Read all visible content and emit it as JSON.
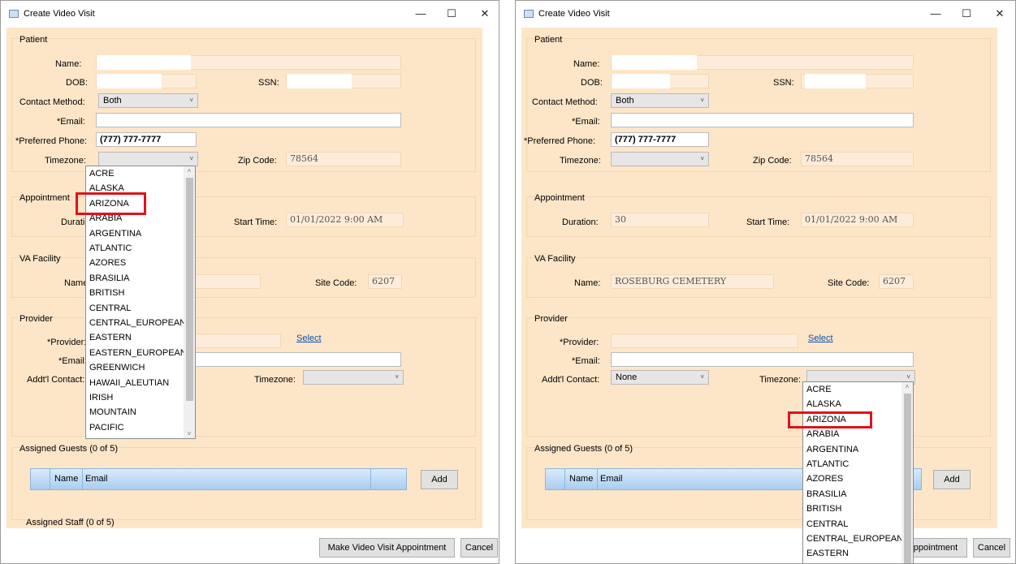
{
  "window": {
    "title": "Create Video Visit",
    "min": "—",
    "max": "☐",
    "close": "✕"
  },
  "patient": {
    "group_title": "Patient",
    "name_label": "Name:",
    "dob_label": "DOB:",
    "ssn_label": "SSN:",
    "contact_label": "Contact Method:",
    "contact_value": "Both",
    "email_label": "*Email:",
    "phone_label": "*Preferred Phone:",
    "phone_value": "(777) 777-7777",
    "timezone_label": "Timezone:",
    "zip_label": "Zip Code:",
    "zip_value": "78564"
  },
  "appointment": {
    "group_title": "Appointment",
    "duration_label": "Duration:",
    "duration_value": "30",
    "start_label": "Start Time:",
    "start_value": "01/01/2022 9:00 AM"
  },
  "facility": {
    "group_title": "VA Facility",
    "name_label": "Name:",
    "name_value": "ROSEBURG CEMETERY",
    "site_label": "Site Code:",
    "site_value": "6207"
  },
  "provider": {
    "group_title": "Provider",
    "provider_label": "*Provider:",
    "select_link": "Select",
    "email_label": "*Email:",
    "addl_label": "Addt'l Contact:",
    "addl_value": "None",
    "timezone_label": "Timezone:"
  },
  "guests": {
    "group_title": "Assigned Guests (0 of 5)",
    "col_name": "Name",
    "col_email": "Email",
    "add_button": "Add"
  },
  "staff_title_partial": "Assigned Staff (0 of 5)",
  "buttons": {
    "make": "Make Video Visit Appointment",
    "make_partial": "ppointment",
    "cancel": "Cancel"
  },
  "timezones_left": [
    "ACRE",
    "ALASKA",
    "ARIZONA",
    "ARABIA",
    "ARGENTINA",
    "ATLANTIC",
    "AZORES",
    "BRASILIA",
    "BRITISH",
    "CENTRAL",
    "CENTRAL_EUROPEAN",
    "EASTERN",
    "EASTERN_EUROPEAN",
    "GREENWICH",
    "HAWAII_ALEUTIAN",
    "IRISH",
    "MOUNTAIN",
    "PACIFIC"
  ],
  "timezones_right": [
    "ACRE",
    "ALASKA",
    "ARIZONA",
    "ARABIA",
    "ARGENTINA",
    "ATLANTIC",
    "AZORES",
    "BRASILIA",
    "BRITISH",
    "CENTRAL",
    "CENTRAL_EUROPEAN",
    "EASTERN"
  ],
  "highlight": {
    "color": "#e0121b",
    "item": "ARIZONA"
  }
}
